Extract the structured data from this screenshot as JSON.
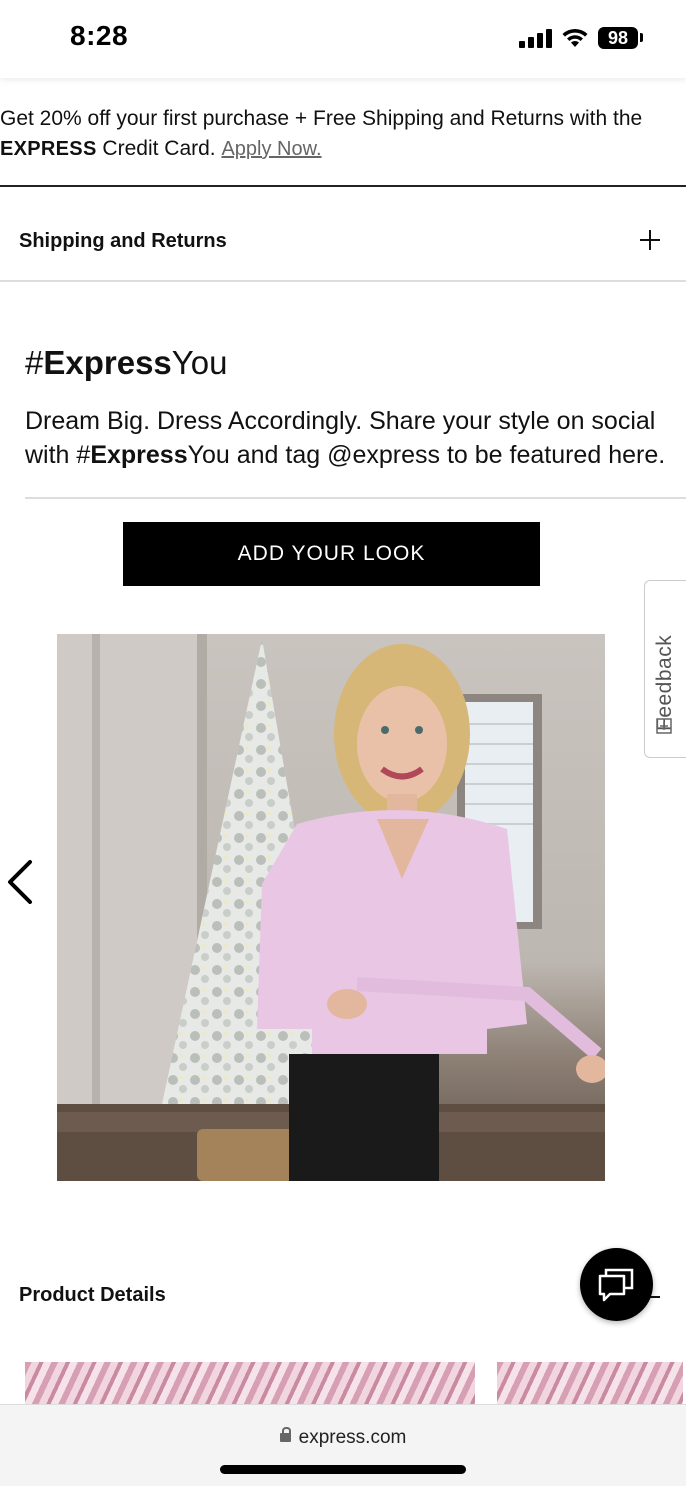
{
  "status_bar": {
    "time": "8:28",
    "battery": "98"
  },
  "promo": {
    "text_before": "Get 20% off your first purchase + Free Shipping and Returns with the ",
    "brand": "EXPRESS",
    "text_after": " Credit Card. ",
    "link": "Apply Now."
  },
  "accordion": {
    "shipping_label": "Shipping and Returns"
  },
  "express_you": {
    "title_prefix": "#",
    "title_bold": "Express",
    "title_suffix": "You",
    "desc_part1": "Dream Big. Dress Accordingly. Share your style on social with #",
    "desc_bold": "Express",
    "desc_part2": "You and tag @express to be featured here.",
    "button_label": "ADD YOUR LOOK"
  },
  "feedback_tab": {
    "label": "Feedback"
  },
  "product_details": {
    "title": "Product Details"
  },
  "browser": {
    "url": "express.com"
  },
  "colors": {
    "button_bg": "#000000",
    "sweater": "#e9c6e4",
    "divider": "#dddddd"
  }
}
